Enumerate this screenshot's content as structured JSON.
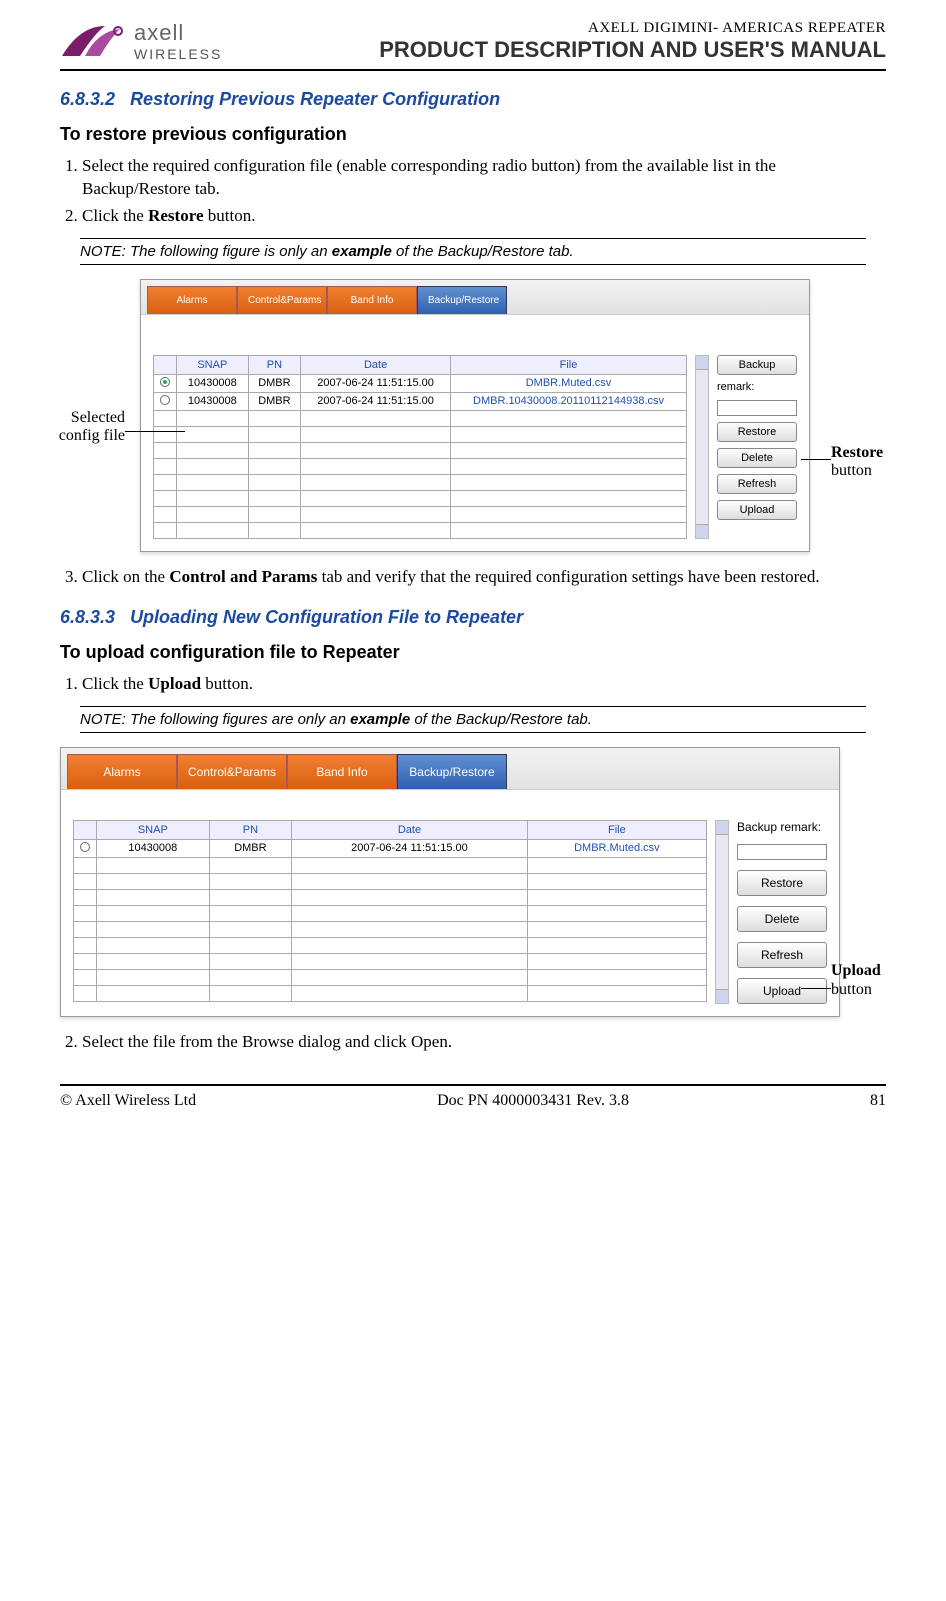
{
  "header": {
    "logo_text": "WIRELESS",
    "small": "AXELL DIGIMINI- AMERICAS REPEATER",
    "big": "PRODUCT DESCRIPTION AND USER'S MANUAL"
  },
  "sec1": {
    "num": "6.8.3.2",
    "title": "Restoring Previous Repeater Configuration",
    "sub": "To restore previous configuration",
    "step1a": "Select the required configuration file (enable corresponding radio button) from the available list in the Backup/Restore tab.",
    "step2a": " Click the ",
    "step2b": "Restore",
    "step2c": " button.",
    "note_a": "NOTE: The following figure is only an ",
    "note_b": "example",
    "note_c": " of the Backup/Restore tab.",
    "step3a": "Click on the ",
    "step3b": "Control and Params",
    "step3c": " tab and verify that the required configuration settings have been restored."
  },
  "sec2": {
    "num": "6.8.3.3",
    "title": "Uploading New Configuration File to Repeater",
    "sub": "To upload configuration file to Repeater",
    "step1a": "Click the ",
    "step1b": "Upload",
    "step1c": " button.",
    "note_a": "NOTE: The following figures are only an ",
    "note_b": "example",
    "note_c": " of the Backup/Restore tab.",
    "step2": "Select the file from the Browse dialog and click Open."
  },
  "tabs": {
    "t1": "Alarms",
    "t2": "Control&Params",
    "t3": "Band Info",
    "t4": "Backup/Restore"
  },
  "gridhdr": {
    "c1": "SNAP",
    "c2": "PN",
    "c3": "Date",
    "c4": "File"
  },
  "fig1rows": [
    {
      "snap": "10430008",
      "pn": "DMBR",
      "date": "2007-06-24 11:51:15.00",
      "file": "DMBR.Muted.csv",
      "checked": true
    },
    {
      "snap": "10430008",
      "pn": "DMBR",
      "date": "2007-06-24 11:51:15.00",
      "file": "DMBR.10430008.20110112144938.csv",
      "checked": false
    }
  ],
  "fig2rows": [
    {
      "snap": "10430008",
      "pn": "DMBR",
      "date": "2007-06-24 11:51:15.00",
      "file": "DMBR.Muted.csv"
    }
  ],
  "side": {
    "backup_label": "Backup remark:",
    "restore": "Restore",
    "backup": "Backup",
    "delete": "Delete",
    "refresh": "Refresh",
    "upload": "Upload"
  },
  "callouts": {
    "selected": "Selected config file",
    "restore_b": "Restore",
    "restore_t": "button",
    "upload_b": "Upload",
    "upload_t": "button"
  },
  "footer": {
    "left": "© Axell Wireless Ltd",
    "center": "Doc PN 4000003431 Rev. 3.8",
    "right": "81"
  }
}
